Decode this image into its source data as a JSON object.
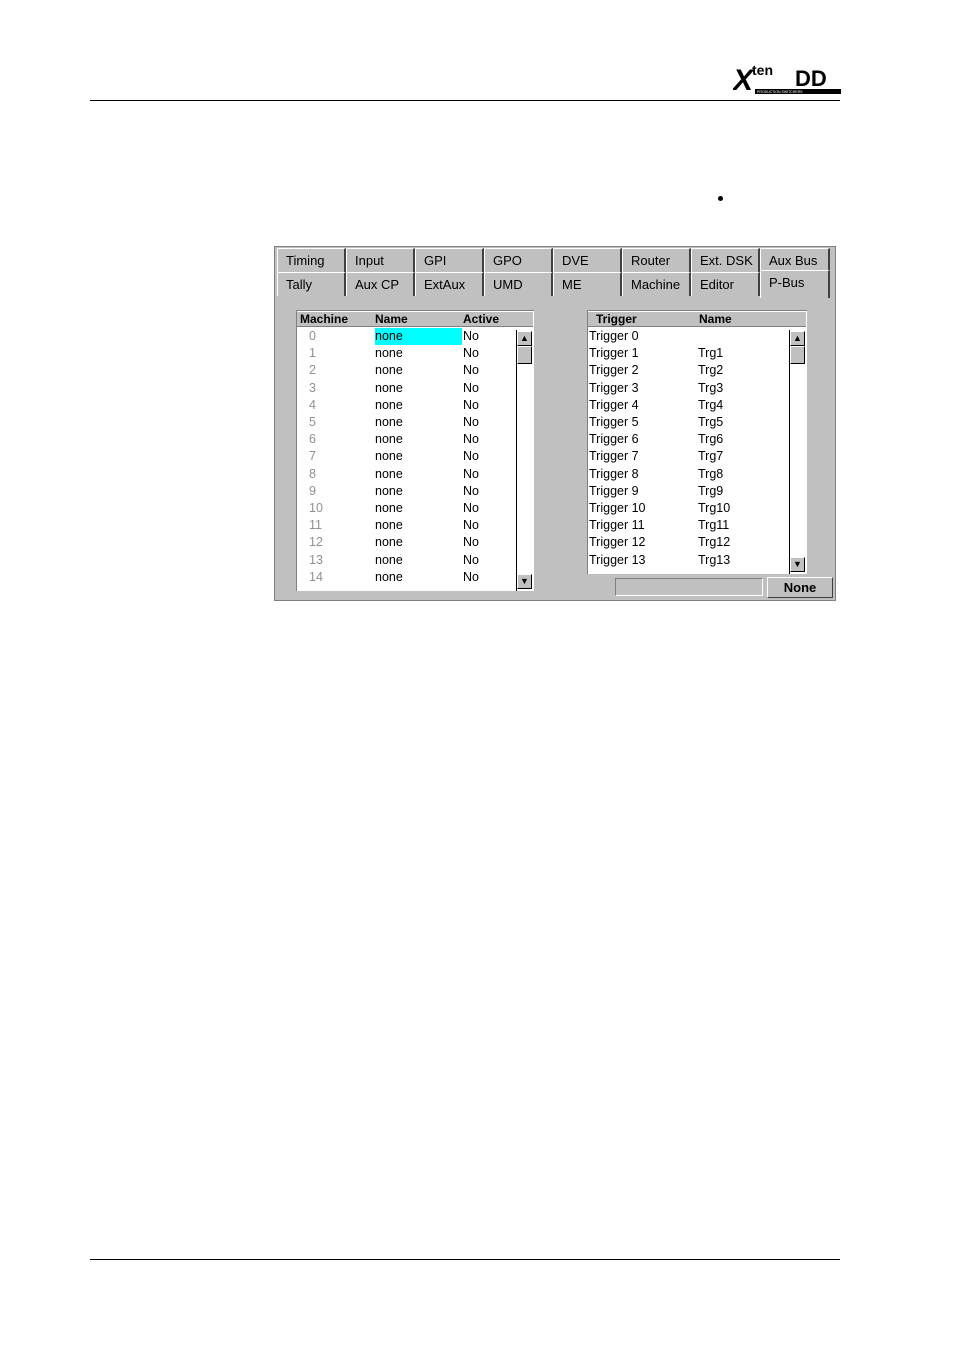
{
  "logo": {
    "text_main": "X",
    "text_super": "ten",
    "text_dd": "DD",
    "tagline": "PRODUCTION SWITCHERS"
  },
  "tabs_row1": [
    "Timing",
    "Input",
    "GPI",
    "GPO",
    "DVE",
    "Router",
    "Ext. DSK",
    "Aux Bus"
  ],
  "tabs_row2": [
    "Tally",
    "Aux CP",
    "ExtAux",
    "UMD",
    "ME",
    "Machine",
    "Editor",
    "P-Bus"
  ],
  "active_tab": "P-Bus",
  "machine_table": {
    "headers": [
      "Machine",
      "Name",
      "Active"
    ],
    "rows": [
      [
        "0",
        "none",
        "No"
      ],
      [
        "1",
        "none",
        "No"
      ],
      [
        "2",
        "none",
        "No"
      ],
      [
        "3",
        "none",
        "No"
      ],
      [
        "4",
        "none",
        "No"
      ],
      [
        "5",
        "none",
        "No"
      ],
      [
        "6",
        "none",
        "No"
      ],
      [
        "7",
        "none",
        "No"
      ],
      [
        "8",
        "none",
        "No"
      ],
      [
        "9",
        "none",
        "No"
      ],
      [
        "10",
        "none",
        "No"
      ],
      [
        "11",
        "none",
        "No"
      ],
      [
        "12",
        "none",
        "No"
      ],
      [
        "13",
        "none",
        "No"
      ],
      [
        "14",
        "none",
        "No"
      ]
    ],
    "selected_row": 0
  },
  "trigger_table": {
    "headers": [
      "Trigger",
      "Name"
    ],
    "rows": [
      [
        "Trigger 0",
        ""
      ],
      [
        "Trigger 1",
        "Trg1"
      ],
      [
        "Trigger 2",
        "Trg2"
      ],
      [
        "Trigger 3",
        "Trg3"
      ],
      [
        "Trigger 4",
        "Trg4"
      ],
      [
        "Trigger 5",
        "Trg5"
      ],
      [
        "Trigger 6",
        "Trg6"
      ],
      [
        "Trigger 7",
        "Trg7"
      ],
      [
        "Trigger 8",
        "Trg8"
      ],
      [
        "Trigger 9",
        "Trg9"
      ],
      [
        "Trigger 10",
        "Trg10"
      ],
      [
        "Trigger 11",
        "Trg11"
      ],
      [
        "Trigger 12",
        "Trg12"
      ],
      [
        "Trigger 13",
        "Trg13"
      ]
    ]
  },
  "status_field": "",
  "none_button": "None",
  "colors": {
    "selection": "#00ffff",
    "face": "#c0c0c0"
  },
  "icons": {
    "up": "scroll-up-arrow-icon",
    "down": "scroll-down-arrow-icon"
  }
}
